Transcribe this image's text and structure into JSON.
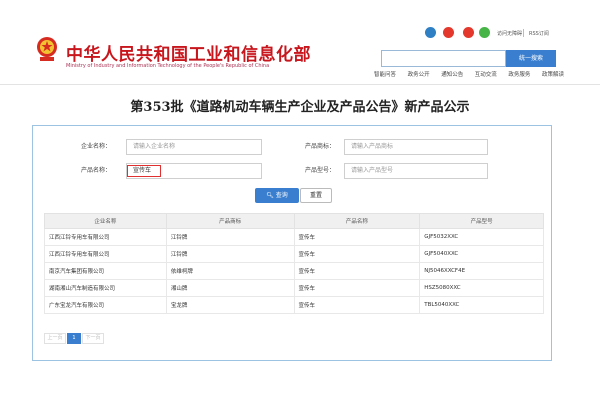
{
  "header": {
    "title_cn": "中华人民共和国工业和信息化部",
    "title_en": "Ministry of Industry and Information Technology of the People's Republic of China",
    "top_links": [
      "访问无障碍",
      "RSS订阅"
    ],
    "search_button": "统一搜索",
    "nav": [
      "智能问答",
      "政务公开",
      "通知公告",
      "互动交流",
      "政务服务",
      "政策解读"
    ]
  },
  "page_heading": "第353批《道路机动车辆生产企业及产品公告》新产品公示",
  "form": {
    "company_label": "企业名称：",
    "company_placeholder": "请输入企业名称",
    "brand_label": "产品商标：",
    "brand_placeholder": "请输入产品商标",
    "product_name_label": "产品名称：",
    "product_name_value": "宣传车",
    "model_label": "产品型号：",
    "model_placeholder": "请输入产品型号",
    "query_button": "查询",
    "reset_button": "重置"
  },
  "table": {
    "columns": [
      "企业名称",
      "产品商标",
      "产品名称",
      "产品型号"
    ],
    "rows": [
      [
        "江西江铃专用车有限公司",
        "江铃牌",
        "宣传车",
        "GJF5032XXC"
      ],
      [
        "江西江铃专用车有限公司",
        "江铃牌",
        "宣传车",
        "GJF5040XXC"
      ],
      [
        "南京汽车集团有限公司",
        "依维柯牌",
        "宣传车",
        "NJ5046XXCF4E"
      ],
      [
        "湖南湘山汽车制造有限公司",
        "湘山牌",
        "宣传车",
        "HSZ5080XXC"
      ],
      [
        "广东宝龙汽车有限公司",
        "宝龙牌",
        "宣传车",
        "TBL5040XXC"
      ]
    ]
  },
  "pagination": {
    "prev": "上一页",
    "current": "1",
    "next": "下一页"
  },
  "colors": {
    "brand_red": "#c8161d",
    "accent_blue": "#3a7fcf",
    "panel_border": "#9cc3e2"
  }
}
